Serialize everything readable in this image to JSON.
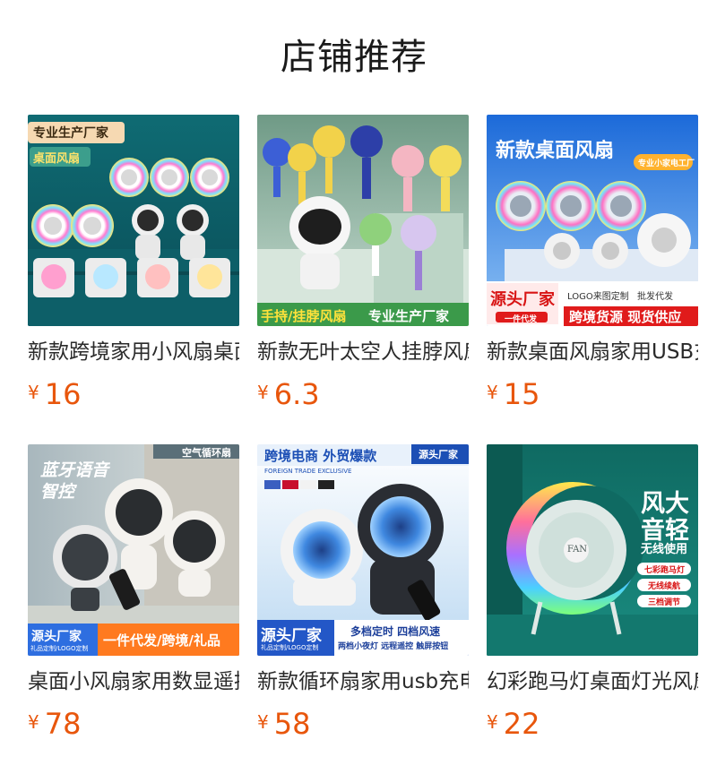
{
  "section_title": "店铺推荐",
  "currency_symbol": "¥",
  "accent_color": "#e8560c",
  "products": [
    {
      "name": "新款跨境家用小风扇桌面风扇",
      "price": "16",
      "image_text": [
        "专业生产厂家",
        "桌面风扇"
      ]
    },
    {
      "name": "新款无叶太空人挂脖风扇手持",
      "price": "6.3",
      "image_text": [
        "手持/挂脖风扇",
        "专业生产厂家"
      ]
    },
    {
      "name": "新款桌面风扇家用USB充电",
      "price": "15",
      "image_text": [
        "新款桌面风扇",
        "专业小家电工厂",
        "源头厂家",
        "一件代发",
        "LOGO来图定制",
        "批发代发",
        "跨境货源 现货供应"
      ]
    },
    {
      "name": "桌面小风扇家用数显遥控",
      "price": "78",
      "image_text": [
        "空气循环扇",
        "蓝牙语音",
        "智控",
        "源头厂家",
        "礼品定制/LOGO定制",
        "一件代发/跨境/礼品"
      ]
    },
    {
      "name": "新款循环扇家用usb充电",
      "price": "58",
      "image_text": [
        "跨境电商 外贸爆款",
        "源头厂家",
        "FOREIGN TRADE EXCLUSIVE",
        "源头厂家",
        "礼品定制/LOGO定制",
        "多档定时 四档风速",
        "两档小夜灯 远程遥控 触屏按钮"
      ]
    },
    {
      "name": "幻彩跑马灯桌面灯光风扇",
      "price": "22",
      "image_text": [
        "风大",
        "音轻",
        "无线使用",
        "七彩跑马灯",
        "无线续航",
        "三档调节",
        "FAN"
      ]
    }
  ]
}
